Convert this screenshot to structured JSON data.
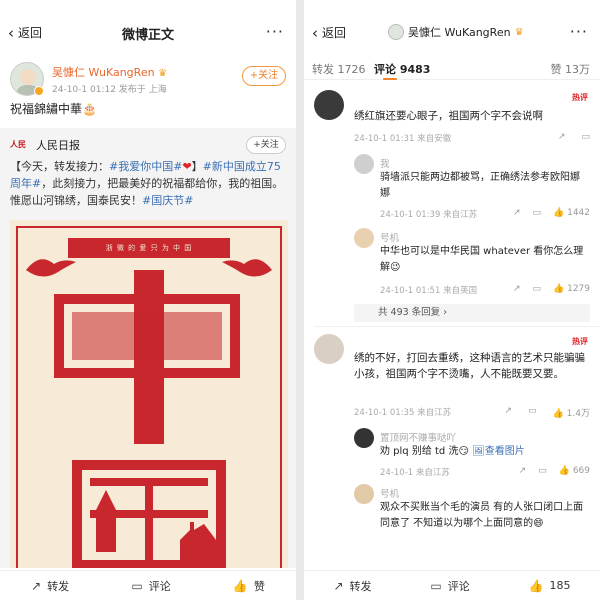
{
  "left": {
    "nav": {
      "back_label": "返回",
      "title": "微博正文",
      "more": "···"
    },
    "author": {
      "name": "吴慷仁 WuKangRen",
      "crown": "♛",
      "meta": "24-10-1 01:12  发布于 上海",
      "follow_label": "+关注"
    },
    "post_text": "祝福錦繡中華🎂",
    "repost": {
      "logo": "人民日报",
      "name": "人民日报",
      "follow_label": "+关注",
      "text_parts": [
        {
          "t": "【今天，转发接力：",
          "tag": false
        },
        {
          "t": "#我爱你中国#",
          "tag": true
        },
        {
          "t": "❤",
          "heart": true
        },
        {
          "t": "】",
          "tag": false
        },
        {
          "t": "#新中国成立75周年#",
          "tag": true
        },
        {
          "t": "，此刻接力，把最美好的祝福都给你，我的祖国。惟愿山河锦绣，国泰民安！",
          "tag": false
        },
        {
          "t": "#国庆节#",
          "tag": true
        }
      ],
      "poster_banner": "浙 微 的 爱   只 为 中 国"
    },
    "bottom": {
      "share": "转发",
      "comment": "评论",
      "like": "赞"
    }
  },
  "right": {
    "nav": {
      "back_label": "返回",
      "user": "吴慷仁 WuKangRen",
      "crown": "♛",
      "more": "···"
    },
    "tabs": {
      "repost": "转发",
      "repost_count": "1726",
      "comment": "评论",
      "comment_count": "9483",
      "like": "赞",
      "like_count": "13万"
    },
    "comments": [
      {
        "name": "",
        "hot": "热评",
        "text": "绣红旗还要心眼子，祖国两个字不会说啊",
        "meta": "24-10-1 01:31 来自安徽",
        "subs": [
          {
            "name": "我",
            "text": "骑墙派只能两边都被骂，正确绣法参考欧阳娜娜",
            "meta": "24-10-1 01:39 来自江苏",
            "likes": "1442"
          },
          {
            "name": "号机",
            "text": "中华也可以是中华民国 whatever 看你怎么理解😉",
            "meta": "24-10-1 01:51 来自英国",
            "likes": "1279"
          }
        ],
        "more_replies": "共 493 条回复 ›"
      },
      {
        "name": "",
        "hot": "热评",
        "text": "绣的不好，打回去重绣，这种语言的艺术只能骗骗小孩，祖国两个字不烫嘴，人不能既要又要。",
        "meta": "24-10-1 01:35 来自江苏",
        "likes": "1.4万",
        "subs": [
          {
            "name": "置顶网不赚事哒吖",
            "text": "劝 plq 别给 td 洗😏",
            "link": "查看图片",
            "meta": "24-10-1 来自江苏",
            "likes": "669"
          },
          {
            "name": "号机",
            "text": "观众不买账当个毛的演员 有的人张口闭口上面同意了 不知道以为哪个上面同意的😄",
            "meta": "",
            "likes": "185"
          }
        ]
      }
    ],
    "bottom": {
      "share": "转发",
      "comment": "评论",
      "like": "赞"
    }
  }
}
